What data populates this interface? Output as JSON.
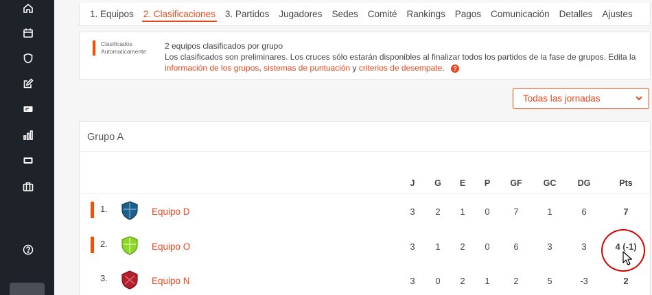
{
  "tabs": [
    {
      "label": "1. Equipos",
      "active": false
    },
    {
      "label": "2. Clasificaciones",
      "active": true
    },
    {
      "label": "3. Partidos",
      "active": false
    },
    {
      "label": "Jugadores",
      "active": false
    },
    {
      "label": "Sedes",
      "active": false
    },
    {
      "label": "Comité",
      "active": false
    },
    {
      "label": "Rankings",
      "active": false
    },
    {
      "label": "Pagos",
      "active": false
    },
    {
      "label": "Comunicación",
      "active": false
    },
    {
      "label": "Detalles",
      "active": false
    },
    {
      "label": "Ajustes",
      "active": false
    }
  ],
  "info": {
    "legend_line1": "Clasificados",
    "legend_line2": "Automaticamente",
    "title": "2 equipos clasificados por grupo",
    "text": "Los clasificados son preliminares. Los cruces sólo estarán disponibles al finalizar todos los partidos de la fase de grupos. Edita la",
    "link1": "información de los grupos",
    "sep1": ",",
    "link2": "sistemas de puntuación",
    "sep2": "y",
    "link3": "criterios de desempate",
    "end": ".",
    "help": "?"
  },
  "filter": {
    "selected": "Todas las jornadas"
  },
  "group": {
    "title": "Grupo A",
    "headers": [
      "J",
      "G",
      "E",
      "P",
      "GF",
      "GC",
      "DG",
      "Pts"
    ],
    "rows": [
      {
        "pos": "1.",
        "team": "Equipo D",
        "qualified": true,
        "color": "#1f5f8b",
        "J": "3",
        "G": "2",
        "E": "1",
        "P": "0",
        "GF": "7",
        "GC": "1",
        "DG": "6",
        "Pts": "7"
      },
      {
        "pos": "2.",
        "team": "Equipo O",
        "qualified": true,
        "color": "#8ed629",
        "J": "3",
        "G": "1",
        "E": "2",
        "P": "0",
        "GF": "6",
        "GC": "3",
        "DG": "3",
        "Pts": "4 (-1)"
      },
      {
        "pos": "3.",
        "team": "Equipo N",
        "qualified": false,
        "color": "#b0202a",
        "J": "3",
        "G": "0",
        "E": "2",
        "P": "1",
        "GF": "2",
        "GC": "5",
        "DG": "-3",
        "Pts": "2"
      }
    ]
  },
  "colors": {
    "accent": "#e8481e",
    "qualified_marker": "#ff4a00",
    "sidebar": "#1e2229",
    "annotation": "#d40000"
  },
  "sidebar_icons": [
    "home-icon",
    "calendar-icon",
    "shield-icon",
    "edit-icon",
    "ticket-icon",
    "stats-icon",
    "id-card-icon",
    "briefcase-icon",
    "help-icon"
  ]
}
